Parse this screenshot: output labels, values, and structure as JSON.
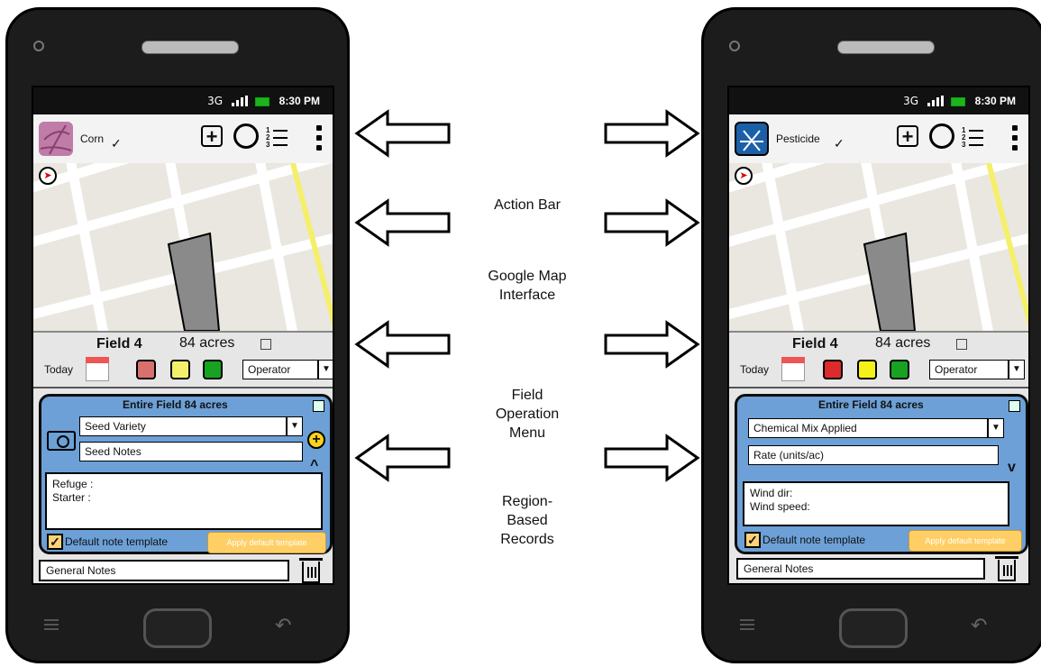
{
  "status": {
    "network": "3G",
    "time": "8:30 PM"
  },
  "phones": {
    "left": {
      "crop": "Corn",
      "field": "Field 4",
      "acres": "84 acres",
      "today": "Today",
      "operator": "Operator",
      "region_title": "Entire Field 84 acres",
      "select1": "Seed Variety",
      "field2": "Seed Notes",
      "notes_line1": "Refuge :",
      "notes_line2": "Starter :",
      "default_template": "Default note template",
      "apply_button": "Apply default template",
      "general_notes": "General Notes",
      "app_icon_color": "#c07ca8",
      "colors": [
        "#d97070",
        "#f2f06a",
        "#17a321"
      ]
    },
    "right": {
      "crop": "Pesticide",
      "field": "Field 4",
      "acres": "84 acres",
      "today": "Today",
      "operator": "Operator",
      "region_title": "Entire Field 84 acres",
      "select1": "Chemical Mix Applied",
      "field2": "Rate (units/ac)",
      "notes_line1": "Wind dir:",
      "notes_line2": "Wind speed:",
      "default_template": "Default note template",
      "apply_button": "Apply default template",
      "general_notes": "General Notes",
      "app_icon_color": "#1b5fa8",
      "colors": [
        "#dd2b2b",
        "#f5f01a",
        "#17a321"
      ]
    }
  },
  "labels": {
    "action_bar": "Action Bar",
    "map_line1": "Google Map",
    "map_line2": "Interface",
    "field_line1": "Field",
    "field_line2": "Operation",
    "field_line3": "Menu",
    "region_line1": "Region-",
    "region_line2": "Based",
    "region_line3": "Records"
  }
}
